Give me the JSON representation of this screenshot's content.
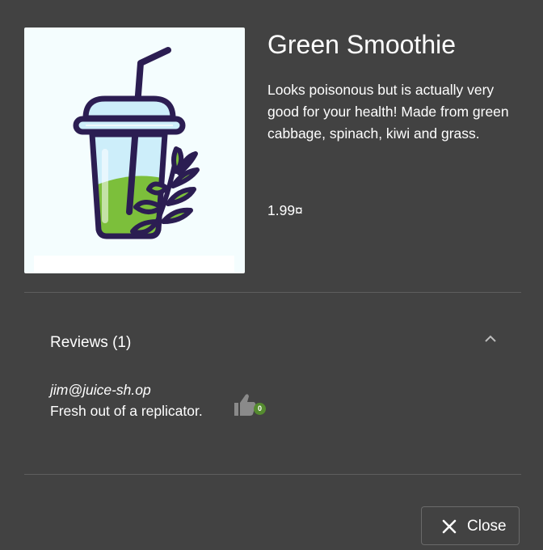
{
  "product": {
    "name": "Green Smoothie",
    "description": "Looks poisonous but is actually very good for your health! Made from green cabbage, spinach, kiwi and grass.",
    "price": "1.99¤",
    "image_icon": "smoothie-cup-icon"
  },
  "reviews": {
    "title": "Reviews (1)",
    "expanded": true,
    "items": [
      {
        "author": "jim@juice-sh.op",
        "text": "Fresh out of a replicator.",
        "likes": "0"
      }
    ]
  },
  "actions": {
    "close_label": "Close"
  },
  "colors": {
    "background": "#424242",
    "image_background": "#f4fdfe",
    "accent_green": "#558b2f",
    "smoothie_green": "#7cbf3b",
    "cup_outline": "#2b1d52"
  }
}
